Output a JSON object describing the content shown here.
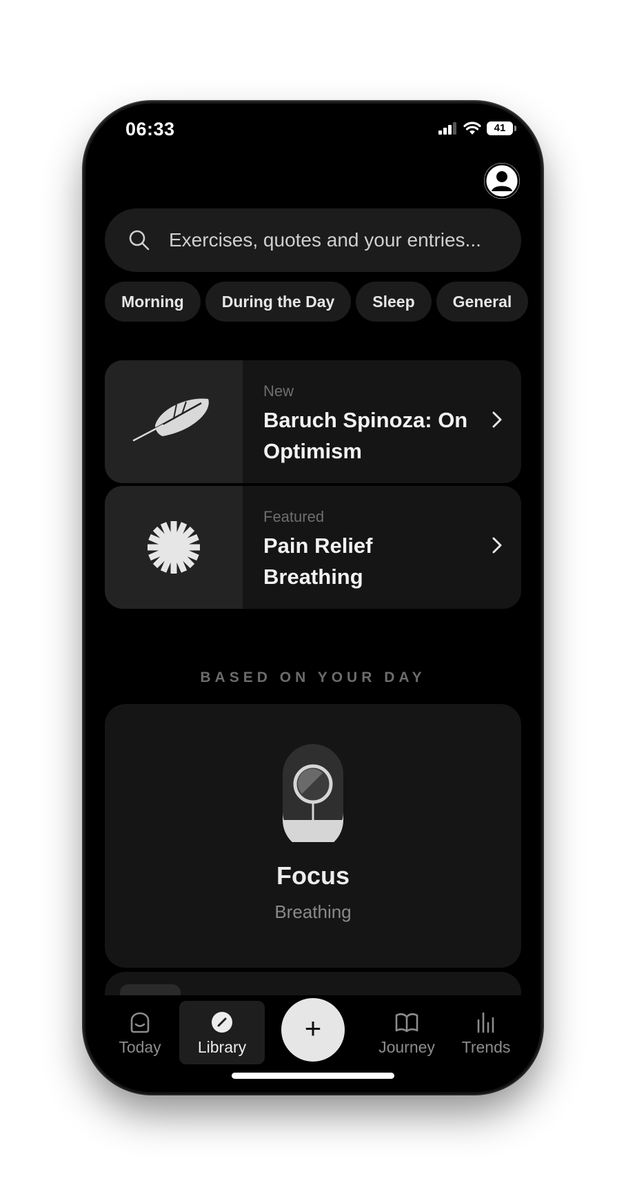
{
  "status_bar": {
    "time": "06:33",
    "battery": "41"
  },
  "search": {
    "placeholder": "Exercises, quotes and your entries..."
  },
  "chips": [
    "Morning",
    "During the Day",
    "Sleep",
    "General"
  ],
  "cards": [
    {
      "kicker": "New",
      "title": "Baruch Spinoza: On Optimism",
      "icon": "feather-icon"
    },
    {
      "kicker": "Featured",
      "title": "Pain Relief Breathing",
      "icon": "starburst-icon"
    }
  ],
  "section_title": "BASED ON YOUR DAY",
  "focus_card": {
    "title": "Focus",
    "subtitle": "Breathing",
    "icon": "magnifier-capsule-icon"
  },
  "tabbar": {
    "today": "Today",
    "library": "Library",
    "add": "+",
    "journey": "Journey",
    "trends": "Trends",
    "selected": "Library"
  },
  "colors": {
    "background": "#000000",
    "card": "#151515",
    "accent": "#e6e6e6"
  }
}
